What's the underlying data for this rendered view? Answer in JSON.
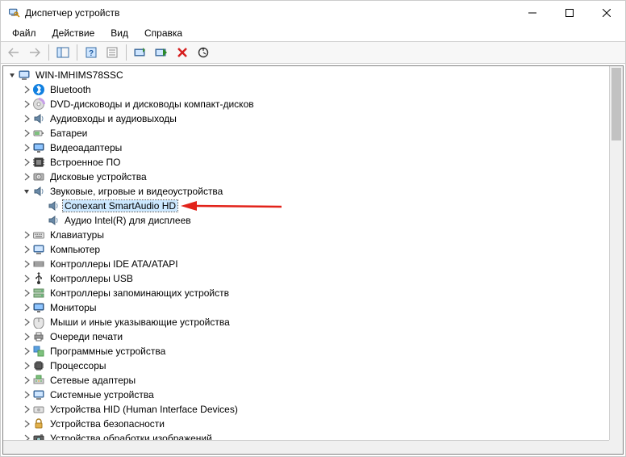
{
  "window": {
    "title": "Диспетчер устройств"
  },
  "menu": {
    "file": "Файл",
    "action": "Действие",
    "view": "Вид",
    "help": "Справка"
  },
  "tree": {
    "root": "WIN-IMHIMS78SSC",
    "items": {
      "bluetooth": "Bluetooth",
      "dvd": "DVD-дисководы и дисководы компакт-дисков",
      "audio_io": "Аудиовходы и аудиовыходы",
      "batteries": "Батареи",
      "video_adapters": "Видеоадаптеры",
      "firmware": "Встроенное ПО",
      "disk_drives": "Дисковые устройства",
      "sound": "Звуковые, игровые и видеоустройства",
      "sound_child_1": "Conexant SmartAudio HD",
      "sound_child_2": "Аудио Intel(R) для дисплеев",
      "keyboards": "Клавиатуры",
      "computer": "Компьютер",
      "ide": "Контроллеры IDE ATA/ATAPI",
      "usb": "Контроллеры USB",
      "storage_ctrl": "Контроллеры запоминающих устройств",
      "monitors": "Мониторы",
      "mice": "Мыши и иные указывающие устройства",
      "print_queues": "Очереди печати",
      "software_devices": "Программные устройства",
      "processors": "Процессоры",
      "net_adapters": "Сетевые адаптеры",
      "system_devices": "Системные устройства",
      "hid": "Устройства HID (Human Interface Devices)",
      "security": "Устройства безопасности",
      "imaging": "Устройства обработки изображений"
    }
  },
  "annotation": {
    "arrow_color": "#e2231a"
  }
}
